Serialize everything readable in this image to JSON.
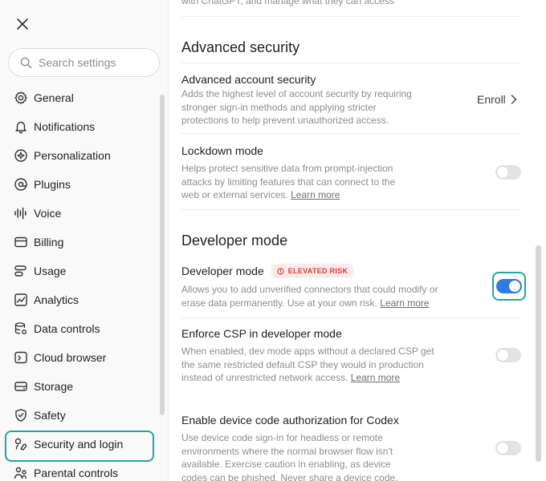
{
  "sidebar": {
    "search_placeholder": "Search settings",
    "items": [
      {
        "label": "General",
        "icon": "gear-icon"
      },
      {
        "label": "Notifications",
        "icon": "bell-icon"
      },
      {
        "label": "Personalization",
        "icon": "sparkle-circle-icon"
      },
      {
        "label": "Plugins",
        "icon": "at-circle-icon"
      },
      {
        "label": "Voice",
        "icon": "waveform-icon"
      },
      {
        "label": "Billing",
        "icon": "credit-card-icon"
      },
      {
        "label": "Usage",
        "icon": "usage-bars-icon"
      },
      {
        "label": "Analytics",
        "icon": "chart-line-icon"
      },
      {
        "label": "Data controls",
        "icon": "database-gear-icon"
      },
      {
        "label": "Cloud browser",
        "icon": "browser-icon"
      },
      {
        "label": "Storage",
        "icon": "storage-drive-icon"
      },
      {
        "label": "Safety",
        "icon": "shield-check-icon"
      },
      {
        "label": "Security and login",
        "icon": "lock-icon",
        "active": true
      },
      {
        "label": "Parental controls",
        "icon": "family-icon"
      }
    ]
  },
  "main": {
    "top_snippet": "with ChatGPT, and manage what they can access",
    "advanced_security": {
      "title": "Advanced security",
      "account_security": {
        "title": "Advanced account security",
        "desc": "Adds the highest level of account security by requiring stronger sign-in methods and applying stricter protections to help prevent unauthorized access.",
        "action": "Enroll"
      },
      "lockdown": {
        "title": "Lockdown mode",
        "desc": "Helps protect sensitive data from prompt-injection attacks by limiting features that can connect to the web or external services.",
        "link": "Learn more",
        "enabled": false
      }
    },
    "developer_mode": {
      "title": "Developer mode",
      "dev_mode": {
        "title": "Developer mode",
        "badge": "ELEVATED RISK",
        "desc": "Allows you to add unverified connectors that could modify or erase data permanently. Use at your own risk.",
        "link": "Learn more",
        "enabled": true
      },
      "csp": {
        "title": "Enforce CSP in developer mode",
        "desc": "When enabled, dev mode apps without a declared CSP get the same restricted default CSP they would in production instead of unrestricted network access.",
        "link": "Learn more",
        "enabled": false
      },
      "device_code": {
        "title": "Enable device code authorization for Codex",
        "desc": "Use device code sign-in for headless or remote environments where the normal browser flow isn't available. Exercise caution in enabling, as device codes can be phished. Never share a device code.",
        "enabled": false
      }
    }
  },
  "colors": {
    "accent_focus": "#22a89a",
    "toggle_on": "#2f7ae5",
    "risk_text": "#d0403a",
    "risk_bg": "#fdeaea"
  }
}
